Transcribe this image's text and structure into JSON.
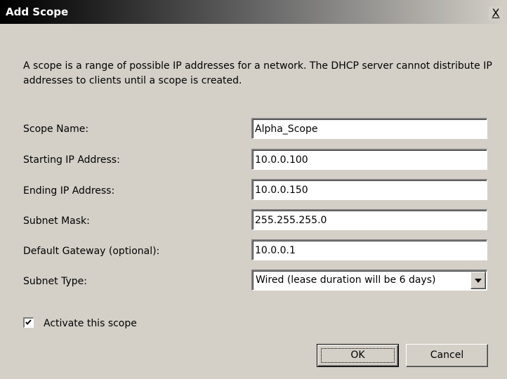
{
  "window": {
    "title": "Add Scope",
    "close_label": "X"
  },
  "description": "A scope is a range of possible IP addresses for a network. The DHCP server cannot distribute IP addresses to clients until a scope is created.",
  "fields": {
    "scope_name": {
      "label": "Scope Name:",
      "value": "Alpha_Scope"
    },
    "starting_ip": {
      "label": "Starting IP Address:",
      "value": "10.0.0.100"
    },
    "ending_ip": {
      "label": "Ending IP Address:",
      "value": "10.0.0.150"
    },
    "subnet_mask": {
      "label": "Subnet Mask:",
      "value": "255.255.255.0"
    },
    "default_gateway": {
      "label": "Default Gateway (optional):",
      "value": "10.0.0.1"
    },
    "subnet_type": {
      "label": "Subnet Type:",
      "selected": "Wired (lease duration will be 6 days)"
    }
  },
  "activate": {
    "label": "Activate this scope",
    "checked": true
  },
  "buttons": {
    "ok": "OK",
    "cancel": "Cancel"
  }
}
